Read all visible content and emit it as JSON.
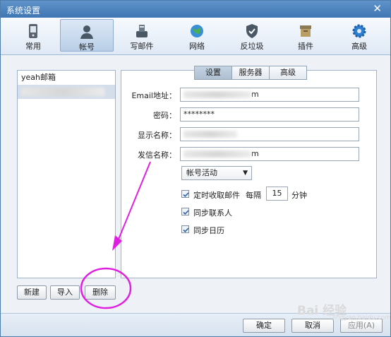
{
  "window": {
    "title": "系统设置",
    "close_glyph": "✕"
  },
  "toolbar": {
    "items": [
      {
        "label": "常用",
        "icon": "phone-icon"
      },
      {
        "label": "帐号",
        "icon": "user-icon"
      },
      {
        "label": "写邮件",
        "icon": "compose-icon"
      },
      {
        "label": "网络",
        "icon": "globe-icon"
      },
      {
        "label": "反垃圾",
        "icon": "shield-icon"
      },
      {
        "label": "插件",
        "icon": "box-icon"
      },
      {
        "label": "高级",
        "icon": "gear-icon"
      }
    ],
    "active_index": 1
  },
  "accounts": {
    "items": [
      {
        "label": "yeah邮箱"
      }
    ],
    "selected_label": ""
  },
  "account_buttons": {
    "new": "新建",
    "import": "导入",
    "delete": "删除"
  },
  "tabs": {
    "items": [
      "设置",
      "服务器",
      "高级"
    ],
    "active_index": 0
  },
  "form": {
    "email_label": "Email地址：",
    "email_suffix": "m",
    "password_label": "密码：",
    "password_value": "********",
    "display_name_label": "显示名称：",
    "sender_name_label": "发信名称：",
    "sender_name_suffix": "m",
    "account_status": "帐号活动"
  },
  "options": {
    "auto_receive_label": "定时收取邮件",
    "auto_receive_checked": true,
    "interval_prefix": "每隔",
    "interval_value": "15",
    "interval_unit": "分钟",
    "sync_contacts_label": "同步联系人",
    "sync_contacts_checked": true,
    "sync_calendar_label": "同步日历",
    "sync_calendar_checked": true
  },
  "footer": {
    "ok": "确定",
    "cancel": "取消",
    "apply": "应用(A)"
  },
  "watermark": {
    "text": "Bai 经验",
    "sub": "jingyan.baidu.com"
  },
  "colors": {
    "title_bar": "#3f76b3",
    "annotation": "#e020e0",
    "selected_row": "#d4deea"
  }
}
